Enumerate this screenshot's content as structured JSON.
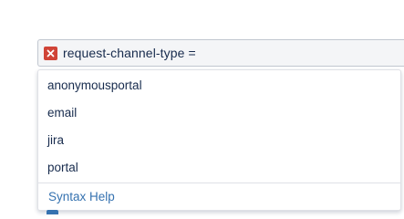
{
  "query": {
    "text": "request-channel-type =",
    "status_icon": "error-x-icon",
    "error_color": "#d04437"
  },
  "suggestions": {
    "options": [
      {
        "label": "anonymousportal"
      },
      {
        "label": "email"
      },
      {
        "label": "jira"
      },
      {
        "label": "portal"
      }
    ],
    "help_link": "Syntax Help",
    "link_color": "#3572b0"
  }
}
